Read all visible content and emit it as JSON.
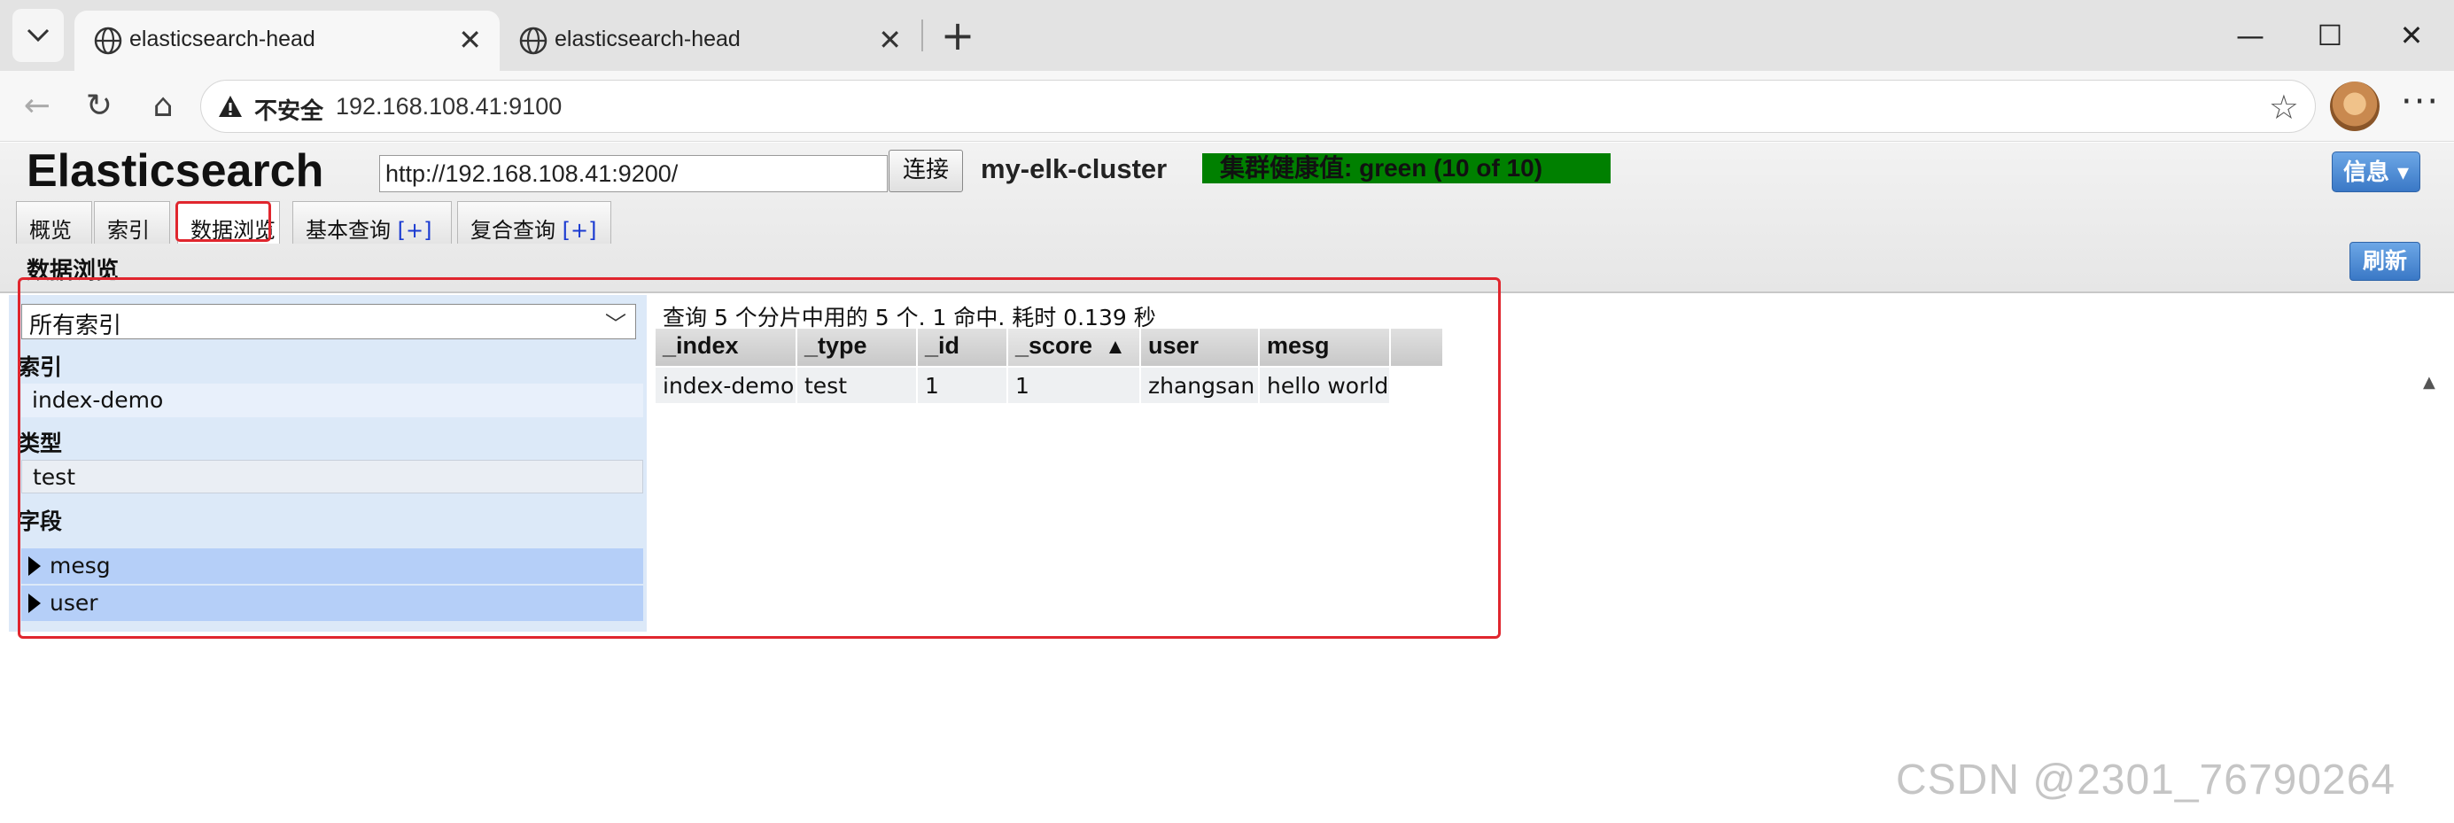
{
  "browser": {
    "tabs": [
      {
        "title": "elasticsearch-head",
        "active": true
      },
      {
        "title": "elasticsearch-head",
        "active": false
      }
    ],
    "security_label": "不安全",
    "url": "192.168.108.41:9100"
  },
  "header": {
    "brand": "Elasticsearch",
    "connect_url": "http://192.168.108.41:9200/",
    "connect_label": "连接",
    "cluster_name": "my-elk-cluster",
    "health_text": "集群健康值: green (10 of 10)",
    "health_color": "#008000",
    "info_label": "信息 ▾"
  },
  "nav_tabs": [
    {
      "label": "概览"
    },
    {
      "label": "索引"
    },
    {
      "label": "数据浏览"
    },
    {
      "label": "基本查询",
      "plus": "[+]"
    },
    {
      "label": "复合查询",
      "plus": "[+]"
    }
  ],
  "section": {
    "title": "数据浏览",
    "refresh_label": "刷新"
  },
  "sidebar": {
    "index_select": "所有索引",
    "index_heading": "索引",
    "index_item": "index-demo",
    "type_heading": "类型",
    "type_item": "test",
    "field_heading": "字段",
    "fields": [
      "mesg",
      "user"
    ]
  },
  "results": {
    "summary": "查询 5 个分片中用的 5 个. 1 命中. 耗时 0.139 秒",
    "columns": [
      "_index",
      "_type",
      "_id",
      "_score",
      "user",
      "mesg"
    ],
    "sort_indicator": "▲",
    "rows": [
      [
        "index-demo",
        "test",
        "1",
        "1",
        "zhangsan",
        "hello world"
      ]
    ]
  },
  "watermark": "CSDN @2301_76790264"
}
